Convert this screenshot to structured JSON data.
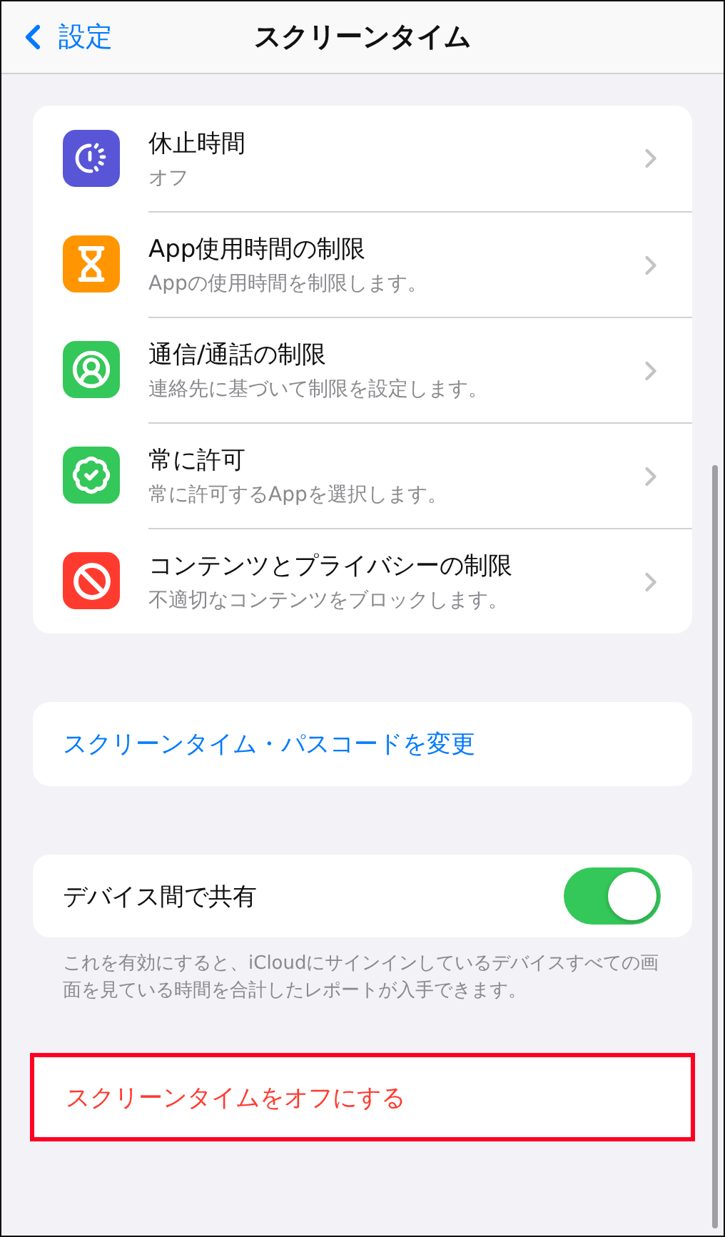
{
  "nav": {
    "back_label": "設定",
    "title": "スクリーンタイム"
  },
  "features": [
    {
      "kind": "downtime",
      "title": "休止時間",
      "subtitle": "オフ",
      "color": "#5856d6"
    },
    {
      "kind": "limits",
      "title": "App使用時間の制限",
      "subtitle": "Appの使用時間を制限します。",
      "color": "#ff9500"
    },
    {
      "kind": "communication",
      "title": "通信/通話の制限",
      "subtitle": "連絡先に基づいて制限を設定します。",
      "color": "#34c759"
    },
    {
      "kind": "allowed",
      "title": "常に許可",
      "subtitle": "常に許可するAppを選択します。",
      "color": "#34c759"
    },
    {
      "kind": "content",
      "title": "コンテンツとプライバシーの制限",
      "subtitle": "不適切なコンテンツをブロックします。",
      "color": "#ff3b30"
    }
  ],
  "passcode_link": "スクリーンタイム・パスコードを変更",
  "share": {
    "label": "デバイス間で共有",
    "on": true,
    "footer": "これを有効にすると、iCloudにサインインしているデバイスすべての画面を見ている時間を合計したレポートが入手できます。"
  },
  "turn_off": {
    "label": "スクリーンタイムをオフにする",
    "highlighted": true
  }
}
